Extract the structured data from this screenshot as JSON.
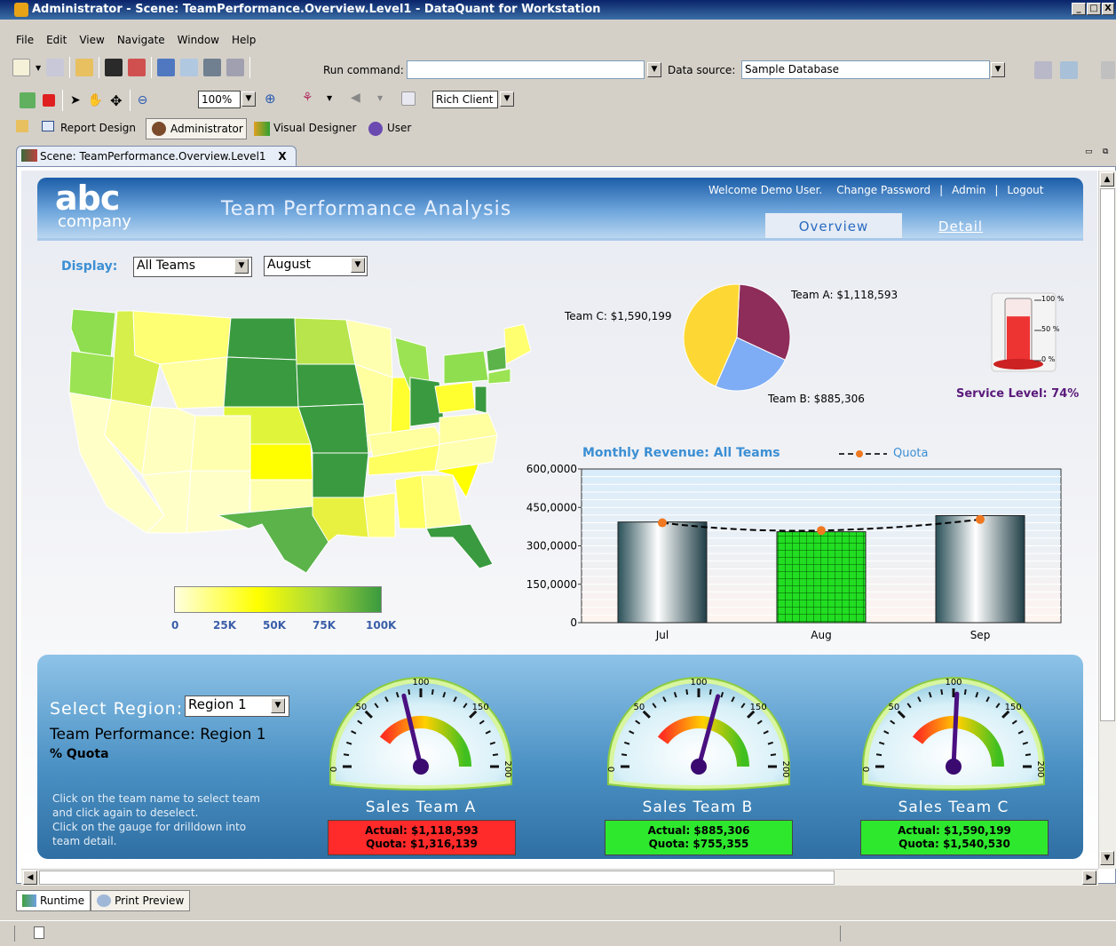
{
  "window": {
    "title": "Administrator - Scene: TeamPerformance.Overview.Level1 - DataQuant for Workstation"
  },
  "menu": [
    "File",
    "Edit",
    "View",
    "Navigate",
    "Window",
    "Help"
  ],
  "toolbar": {
    "run_command_label": "Run command:",
    "run_command_value": "",
    "data_source_label": "Data source:",
    "data_source_value": "Sample Database",
    "zoom_value": "100%",
    "client_value": "Rich Client"
  },
  "perspectives": [
    "Report Design",
    "Administrator",
    "Visual Designer",
    "User"
  ],
  "editor_tab": {
    "label": "Scene: TeamPerformance.Overview.Level1",
    "close": "X"
  },
  "header": {
    "logo_top": "abc",
    "logo_bottom": "company",
    "app_title": "Team Performance Analysis",
    "welcome": "Welcome Demo User.",
    "change_password": "Change Password",
    "admin": "Admin",
    "logout": "Logout",
    "sep": "|",
    "tabs": {
      "overview": "Overview",
      "detail": "Detail"
    }
  },
  "display": {
    "label": "Display:",
    "team_value": "All Teams",
    "month_value": "August"
  },
  "map_legend": {
    "ticks": [
      "0",
      "25K",
      "50K",
      "75K",
      "100K"
    ]
  },
  "pie": {
    "chart_data": {
      "type": "pie",
      "slices": [
        {
          "label": "Team A: $1,118,593",
          "value": 1118593,
          "color": "#8e2c5a"
        },
        {
          "label": "Team B: $885,306",
          "value": 885306,
          "color": "#7eadf5"
        },
        {
          "label": "Team C: $1,590,199",
          "value": 1590199,
          "color": "#fdd835"
        }
      ]
    }
  },
  "thermometer": {
    "ticks": [
      "100 %",
      "50 %",
      "0 %"
    ],
    "label": "Service Level: 74%",
    "level": 0.74
  },
  "chart_data": {
    "type": "bar",
    "title": "Monthly Revenue: All Teams",
    "legend": "Quota",
    "categories": [
      "Jul",
      "Aug",
      "Sep"
    ],
    "series": [
      {
        "name": "Revenue",
        "values": [
          393000,
          355000,
          418000
        ]
      },
      {
        "name": "Quota",
        "values": [
          390000,
          360000,
          403000
        ]
      }
    ],
    "yticks": [
      "600,0000",
      "450,0000",
      "300,0000",
      "150,0000",
      "0"
    ],
    "ylim": [
      0,
      600000
    ]
  },
  "region": {
    "select_label": "Select Region:",
    "region_value": "Region 1",
    "title": "Team Performance: Region 1",
    "subtitle": "% Quota",
    "help1": "Click on the team name to select team",
    "help2": "and click again to deselect.",
    "help3": "Click on the gauge for drilldown into",
    "help4": "team detail."
  },
  "gauges": [
    {
      "name": "Sales Team A",
      "actual": "Actual: $1,118,593",
      "quota": "Quota: $1,316,139",
      "pct": 85,
      "color": "#ff2a2a"
    },
    {
      "name": "Sales Team B",
      "actual": "Actual: $885,306",
      "quota": "Quota: $755,355",
      "pct": 117,
      "color": "#2ee82e"
    },
    {
      "name": "Sales Team C",
      "actual": "Actual: $1,590,199",
      "quota": "Quota: $1,540,530",
      "pct": 103,
      "color": "#2ee82e"
    }
  ],
  "gauge_ticks": [
    "0",
    "50",
    "100",
    "150",
    "200"
  ],
  "bottom_tabs": [
    "Runtime",
    "Print Preview"
  ]
}
